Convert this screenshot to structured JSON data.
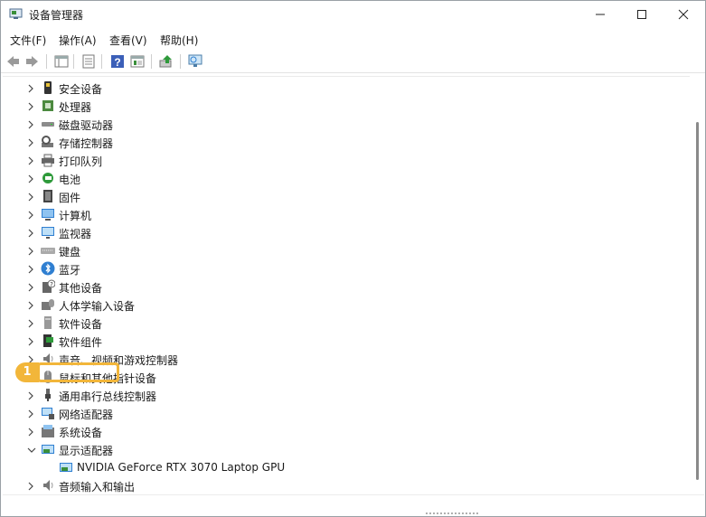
{
  "window": {
    "title": "设备管理器"
  },
  "menu": [
    "文件(F)",
    "操作(A)",
    "查看(V)",
    "帮助(H)"
  ],
  "tree": {
    "items": [
      {
        "label": "安全设备",
        "icon": "security-device-icon"
      },
      {
        "label": "处理器",
        "icon": "processor-icon"
      },
      {
        "label": "磁盘驱动器",
        "icon": "disk-drive-icon"
      },
      {
        "label": "存储控制器",
        "icon": "storage-controller-icon"
      },
      {
        "label": "打印队列",
        "icon": "printer-icon"
      },
      {
        "label": "电池",
        "icon": "battery-icon"
      },
      {
        "label": "固件",
        "icon": "firmware-icon"
      },
      {
        "label": "计算机",
        "icon": "computer-icon"
      },
      {
        "label": "监视器",
        "icon": "monitor-icon"
      },
      {
        "label": "键盘",
        "icon": "keyboard-icon"
      },
      {
        "label": "蓝牙",
        "icon": "bluetooth-icon"
      },
      {
        "label": "其他设备",
        "icon": "other-device-icon"
      },
      {
        "label": "人体学输入设备",
        "icon": "hid-icon"
      },
      {
        "label": "软件设备",
        "icon": "software-device-icon"
      },
      {
        "label": "软件组件",
        "icon": "software-component-icon"
      },
      {
        "label": "声音、视频和游戏控制器",
        "icon": "speaker-icon"
      },
      {
        "label": "鼠标和其他指针设备",
        "icon": "mouse-icon"
      },
      {
        "label": "通用串行总线控制器",
        "icon": "usb-icon"
      },
      {
        "label": "网络适配器",
        "icon": "network-adapter-icon"
      },
      {
        "label": "系统设备",
        "icon": "system-device-icon"
      },
      {
        "label": "显示适配器",
        "icon": "display-adapter-icon"
      },
      {
        "label": "NVIDIA GeForce RTX 3070 Laptop GPU",
        "icon": "gpu-icon"
      },
      {
        "label": "音频输入和输出",
        "icon": "audio-io-icon"
      }
    ],
    "expanded": "显示适配器"
  },
  "annotation": {
    "step": "1"
  },
  "colors": {
    "highlight": "#f2b63a",
    "icon_blue": "#2f7fd1"
  }
}
